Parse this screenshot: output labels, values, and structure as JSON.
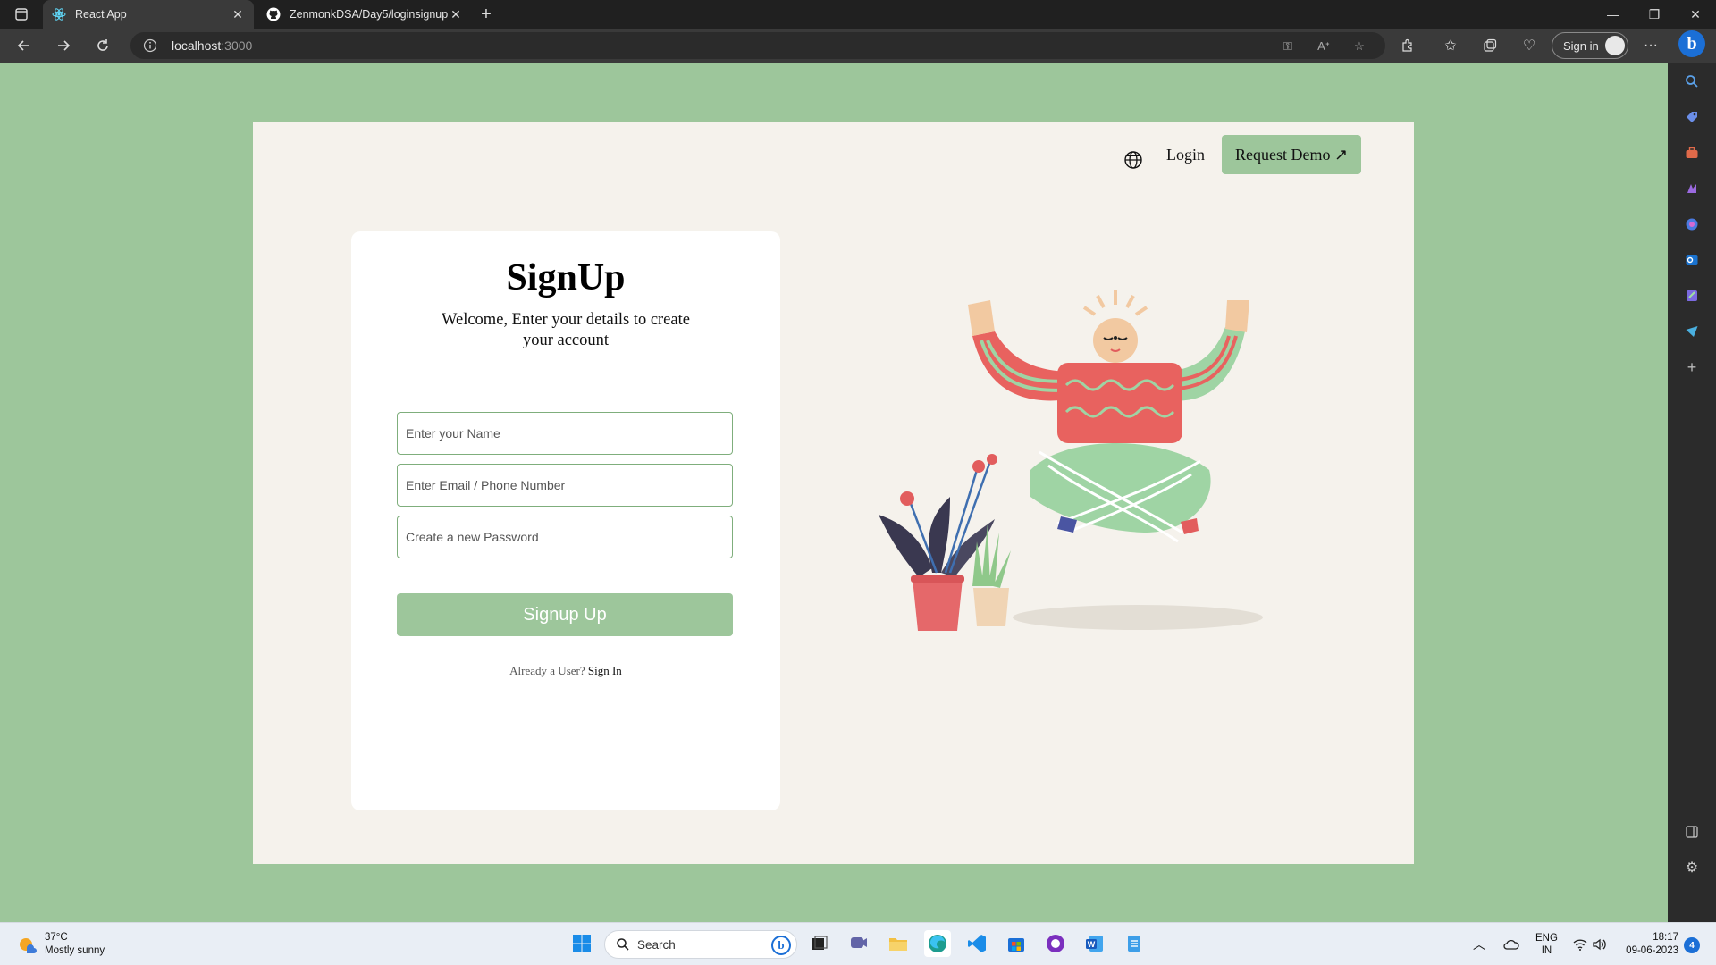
{
  "browser": {
    "tabs": [
      {
        "title": "React App",
        "active": true
      },
      {
        "title": "ZenmonkDSA/Day5/loginsignup",
        "active": false
      }
    ],
    "url_host": "localhost",
    "url_port": ":3000",
    "signin_label": "Sign in"
  },
  "navbar": {
    "login_label": "Login",
    "demo_label": "Request Demo ↗"
  },
  "form": {
    "title": "SignUp",
    "subtitle": "Welcome, Enter your details to create your account",
    "name_placeholder": "Enter your Name",
    "email_placeholder": "Enter Email / Phone Number",
    "password_placeholder": "Create a new Password",
    "submit_label": "Signup Up",
    "already_text": "Already a User?",
    "signin_link": "Sign In"
  },
  "colors": {
    "background_green": "#9dc69b",
    "card_cream": "#f5f2ec",
    "sweater_red": "#e8625f",
    "stripe_green": "#9fd4a4"
  },
  "taskbar": {
    "weather_temp": "37°C",
    "weather_desc": "Mostly sunny",
    "search_label": "Search",
    "lang_top": "ENG",
    "lang_bottom": "IN",
    "time": "18:17",
    "date": "09-06-2023",
    "notification_count": "4"
  }
}
